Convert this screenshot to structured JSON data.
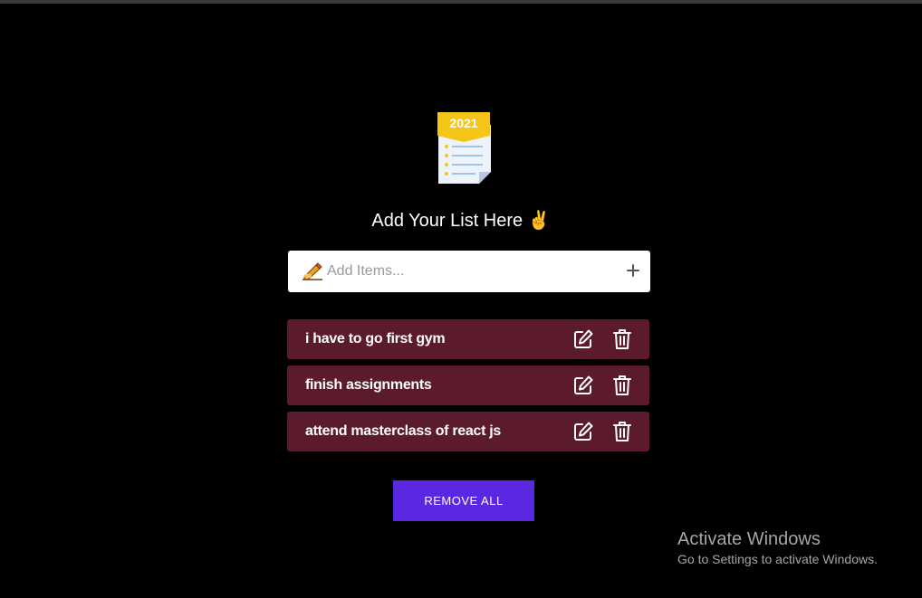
{
  "logo": {
    "year_label": "2021"
  },
  "heading": {
    "text": "Add Your List Here ✌️"
  },
  "input": {
    "placeholder": "Add Items...",
    "value": ""
  },
  "items": [
    {
      "label": "i have to go first gym"
    },
    {
      "label": "finish assignments"
    },
    {
      "label": "attend masterclass of react js"
    }
  ],
  "remove_all_label": "REMOVE ALL",
  "watermark": {
    "title": "Activate Windows",
    "subtitle": "Go to Settings to activate Windows."
  },
  "colors": {
    "background": "#000000",
    "item_background": "#5c1b2d",
    "button_background": "#5a28e0",
    "logo_accent": "#f5c518"
  },
  "icons": {
    "logo": "checklist-document-icon",
    "input_prefix": "writing-hand-icon",
    "add": "plus-icon",
    "edit": "edit-icon",
    "delete": "trash-icon"
  }
}
